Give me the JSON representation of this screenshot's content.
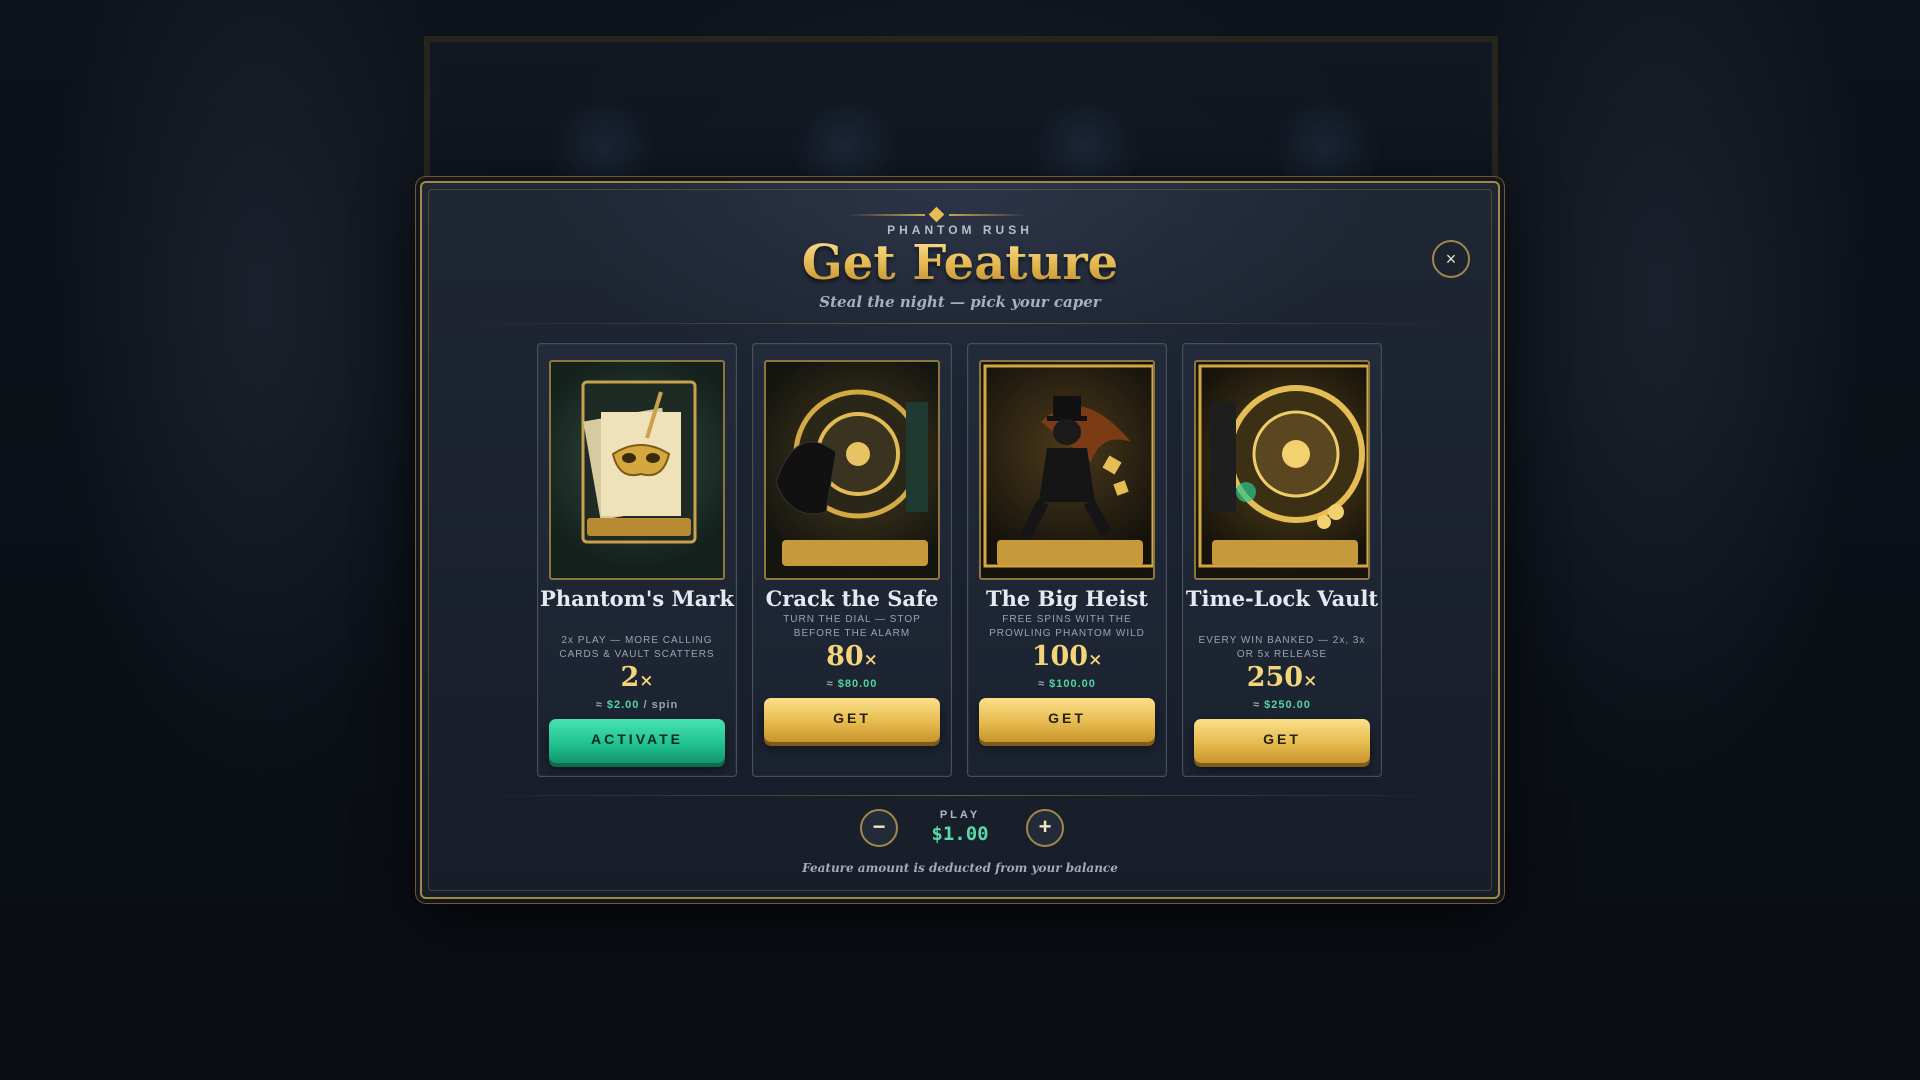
{
  "header": {
    "brand": "PHANTOM RUSH",
    "title": "Get Feature",
    "subtitle": "Steal the night — pick your caper",
    "close_label": "×"
  },
  "cards": [
    {
      "name": "Phantom's Mark",
      "desc": "2x PLAY — MORE CALLING CARDS & VAULT SCATTERS",
      "mult": "2",
      "price_prefix": "≈ ",
      "price": "$2.00",
      "price_suffix": " / spin",
      "button": "ACTIVATE",
      "art_icon": "mask-calling-card-icon"
    },
    {
      "name": "Crack the Safe",
      "desc": "TURN THE DIAL — STOP BEFORE THE ALARM",
      "mult": "80",
      "price_prefix": "≈ ",
      "price": "$80.00",
      "price_suffix": "",
      "button": "GET",
      "art_icon": "safe-dial-icon"
    },
    {
      "name": "The Big Heist",
      "desc": "FREE SPINS WITH THE PROWLING PHANTOM WILD",
      "mult": "100",
      "price_prefix": "≈ ",
      "price": "$100.00",
      "price_suffix": "",
      "button": "GET",
      "art_icon": "phantom-thief-icon"
    },
    {
      "name": "Time-Lock Vault",
      "desc": "EVERY WIN BANKED — 2x, 3x OR 5x RELEASE",
      "mult": "250",
      "price_prefix": "≈ ",
      "price": "$250.00",
      "price_suffix": "",
      "button": "GET",
      "art_icon": "vault-door-icon"
    }
  ],
  "mult_suffix": "×",
  "play": {
    "label": "PLAY",
    "value": "$1.00",
    "minus_label": "−",
    "plus_label": "+"
  },
  "footer_note": "Feature amount is deducted from your balance",
  "colors": {
    "gold": "#e7c267",
    "green": "#1fc08e",
    "frame": "#a2874a",
    "panel": "#1b2230"
  }
}
